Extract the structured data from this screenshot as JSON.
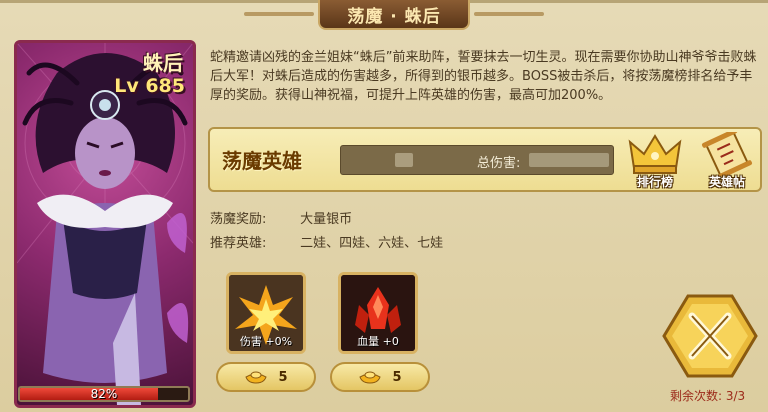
{
  "window": {
    "title": "荡魔 · 蛛后"
  },
  "boss": {
    "name": "蛛后",
    "level": "Lv 685",
    "hp_text": "82%",
    "hp_fraction": 0.82,
    "hp_color": "#d62a1c"
  },
  "description": "蛇精邀请凶残的金兰姐妹“蛛后”前来助阵，誓要抹去一切生灵。现在需要你协助山神爷爷击败蛛后大军！对蛛后造成的伤害越多，所得到的银币越多。BOSS被击杀后，将按荡魔榜排名给予丰厚的奖励。获得山神祝福，可提升上阵英雄的伤害，最高可加200%。",
  "hero_banner": {
    "title": "荡魔英雄",
    "damage_label": "总伤害:",
    "rank_button": "排行榜",
    "herobook_button": "英雄帖"
  },
  "rewards": {
    "label": "荡魔奖励:",
    "value": "大量银币"
  },
  "recommend": {
    "label": "推荐英雄:",
    "value": "二娃、四娃、六娃、七娃"
  },
  "buffs": [
    {
      "label": "伤害 +0%",
      "cost": "5",
      "icon": "explosion-icon"
    },
    {
      "label": "血量 +0",
      "cost": "5",
      "icon": "blood-crystal-icon"
    }
  ],
  "remaining": "剩余次数: 3/3",
  "colors": {
    "accent": "#d8b262",
    "boss_frame": "#8a2a4e",
    "remain_text": "#9c2a1a"
  }
}
